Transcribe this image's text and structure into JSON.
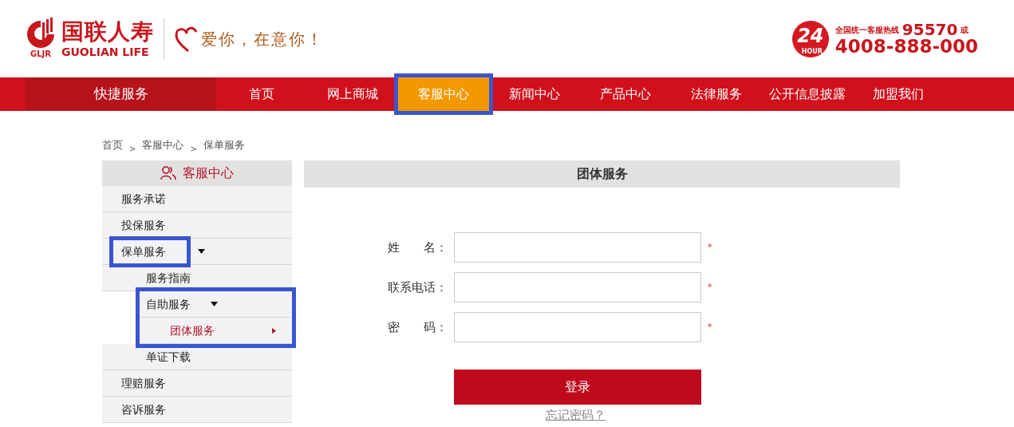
{
  "header": {
    "logo_mark": "GLJR",
    "brand_cn": "国联人寿",
    "brand_en": "GUOLIAN LIFE",
    "slogan": "爱你，在意你！",
    "hotline_badge": "24",
    "hotline_badge_sub": "HOUR",
    "hotline_label": "全国统一客服热线",
    "hotline_short": "95570",
    "hotline_or": "或",
    "hotline_long": "4008-888-000"
  },
  "nav": {
    "quick": "快捷服务",
    "items": [
      {
        "label": "首页",
        "selected": false,
        "highlighted": false
      },
      {
        "label": "网上商城",
        "selected": false,
        "highlighted": false
      },
      {
        "label": "客服中心",
        "selected": true,
        "highlighted": true
      },
      {
        "label": "新闻中心",
        "selected": false,
        "highlighted": false
      },
      {
        "label": "产品中心",
        "selected": false,
        "highlighted": false
      },
      {
        "label": "法律服务",
        "selected": false,
        "highlighted": false
      },
      {
        "label": "公开信息披露",
        "selected": false,
        "highlighted": false
      },
      {
        "label": "加盟我们",
        "selected": false,
        "highlighted": false
      }
    ]
  },
  "breadcrumb": [
    "首页",
    "客服中心",
    "保单服务"
  ],
  "breadcrumb_separator": ">",
  "sidebar": {
    "title": "客服中心",
    "items": [
      {
        "label": "服务承诺",
        "expanded": false,
        "selected": false,
        "highlighted": false
      },
      {
        "label": "投保服务",
        "expanded": false,
        "selected": false,
        "highlighted": false
      },
      {
        "label": "保单服务",
        "expanded": true,
        "selected": false,
        "highlighted": true,
        "children": [
          {
            "label": "服务指南",
            "expanded": false,
            "selected": false,
            "highlighted": false
          },
          {
            "label": "自助服务",
            "expanded": true,
            "selected": false,
            "highlighted": true,
            "children": [
              {
                "label": "团体服务",
                "expanded": false,
                "selected": true,
                "highlighted": false
              }
            ]
          },
          {
            "label": "单证下载",
            "expanded": false,
            "selected": false,
            "highlighted": false
          }
        ]
      },
      {
        "label": "理赔服务",
        "expanded": false,
        "selected": false,
        "highlighted": false
      },
      {
        "label": "咨诉服务",
        "expanded": false,
        "selected": false,
        "highlighted": false
      }
    ]
  },
  "panel": {
    "title": "团体服务",
    "fields": [
      {
        "label": "姓　　名：",
        "required": true
      },
      {
        "label": "联系电话：",
        "required": true
      },
      {
        "label": "密　　码：",
        "required": true
      }
    ],
    "required_mark": "*",
    "submit": "登录",
    "forgot": "忘记密码？"
  }
}
